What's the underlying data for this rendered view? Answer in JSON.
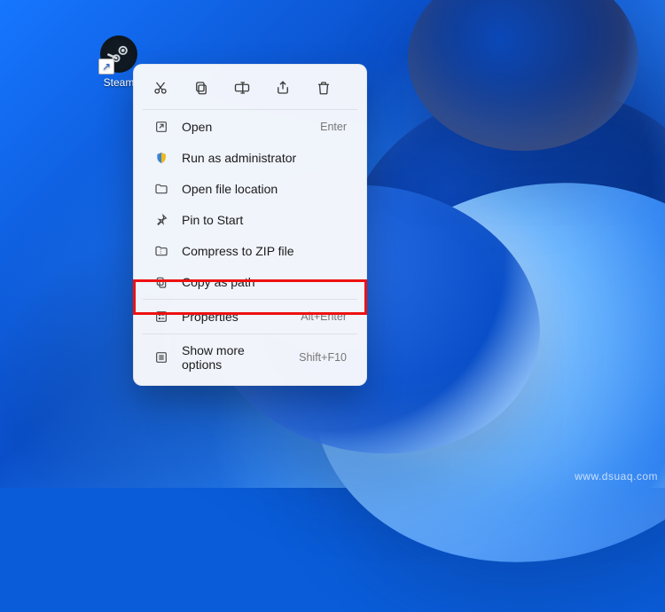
{
  "desktop": {
    "icon_label": "Steam",
    "icon_name": "steam-logo-icon"
  },
  "action_bar": {
    "cut": "cut-icon",
    "copy": "copy-icon",
    "rename": "rename-icon",
    "share": "share-icon",
    "delete": "trash-icon"
  },
  "menu": {
    "items": [
      {
        "icon": "open-icon",
        "label": "Open",
        "accel": "Enter"
      },
      {
        "icon": "shield-icon",
        "label": "Run as administrator",
        "accel": ""
      },
      {
        "icon": "folder-icon",
        "label": "Open file location",
        "accel": ""
      },
      {
        "icon": "pin-icon",
        "label": "Pin to Start",
        "accel": ""
      },
      {
        "icon": "zip-icon",
        "label": "Compress to ZIP file",
        "accel": ""
      },
      {
        "icon": "copy-path-icon",
        "label": "Copy as path",
        "accel": ""
      },
      {
        "icon": "properties-icon",
        "label": "Properties",
        "accel": "Alt+Enter",
        "highlighted": true
      },
      {
        "icon": "more-icon",
        "label": "Show more options",
        "accel": "Shift+F10"
      }
    ]
  },
  "annotation": {
    "watermark": "www.dsuaq.com"
  }
}
